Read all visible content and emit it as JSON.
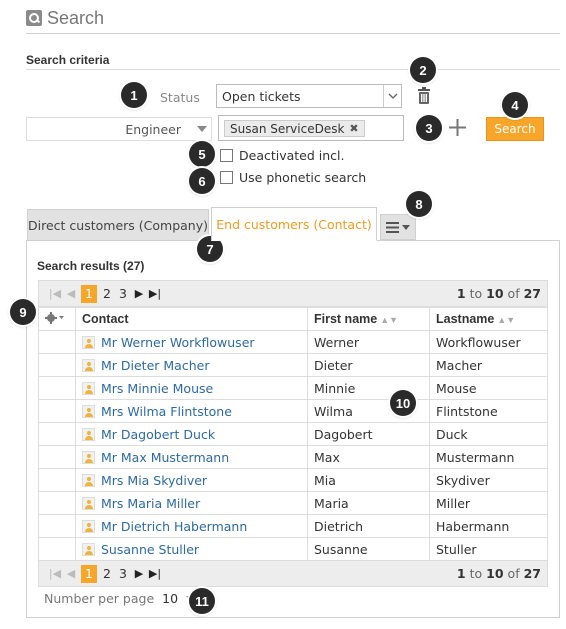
{
  "page": {
    "title": "Search"
  },
  "criteria": {
    "heading": "Search criteria",
    "status_label": "Status",
    "status_value": "Open tickets",
    "role_value": "Engineer",
    "token_value": "Susan ServiceDesk",
    "search_label": "Search",
    "deactivated_label": "Deactivated incl.",
    "phonetic_label": "Use phonetic search"
  },
  "tabs": {
    "company": "Direct customers (Company)",
    "contact": "End customers (Contact)"
  },
  "results": {
    "heading": "Search results (27)",
    "pager": {
      "pages": [
        "1",
        "2",
        "3"
      ],
      "active": "1",
      "info_from": "1",
      "info_to_word": "to",
      "info_to": "10",
      "info_of_word": "of",
      "info_total": "27"
    },
    "columns": {
      "contact": "Contact",
      "first_name": "First name",
      "last_name": "Lastname"
    },
    "rows": [
      {
        "contact": "Mr Werner Workflowuser",
        "first": "Werner",
        "last": "Workflowuser"
      },
      {
        "contact": "Mr Dieter Macher",
        "first": "Dieter",
        "last": "Macher"
      },
      {
        "contact": "Mrs Minnie Mouse",
        "first": "Minnie",
        "last": "Mouse"
      },
      {
        "contact": "Mrs Wilma Flintstone",
        "first": "Wilma",
        "last": "Flintstone"
      },
      {
        "contact": "Mr Dagobert Duck",
        "first": "Dagobert",
        "last": "Duck"
      },
      {
        "contact": "Mr Max Mustermann",
        "first": "Max",
        "last": "Mustermann"
      },
      {
        "contact": "Mrs Mia Skydiver",
        "first": "Mia",
        "last": "Skydiver"
      },
      {
        "contact": "Mrs Maria Miller",
        "first": "Maria",
        "last": "Miller"
      },
      {
        "contact": "Mr Dietrich Habermann",
        "first": "Dietrich",
        "last": "Habermann"
      },
      {
        "contact": "Susanne Stuller",
        "first": "Susanne",
        "last": "Stuller"
      }
    ],
    "page_size_label": "Number per page",
    "page_size_value": "10"
  },
  "callouts": [
    "1",
    "2",
    "3",
    "4",
    "5",
    "6",
    "7",
    "8",
    "9",
    "10",
    "11"
  ],
  "icons": {
    "title": "search-icon",
    "trash": "trash-icon",
    "add": "plus-icon",
    "menu": "list-menu-icon",
    "gear": "gear-icon",
    "person": "person-icon"
  },
  "colors": {
    "accent": "#f8a62a",
    "active_tab_text": "#f29b1f",
    "link": "#2d6aa3",
    "callout_bg": "#2a2a2a"
  }
}
